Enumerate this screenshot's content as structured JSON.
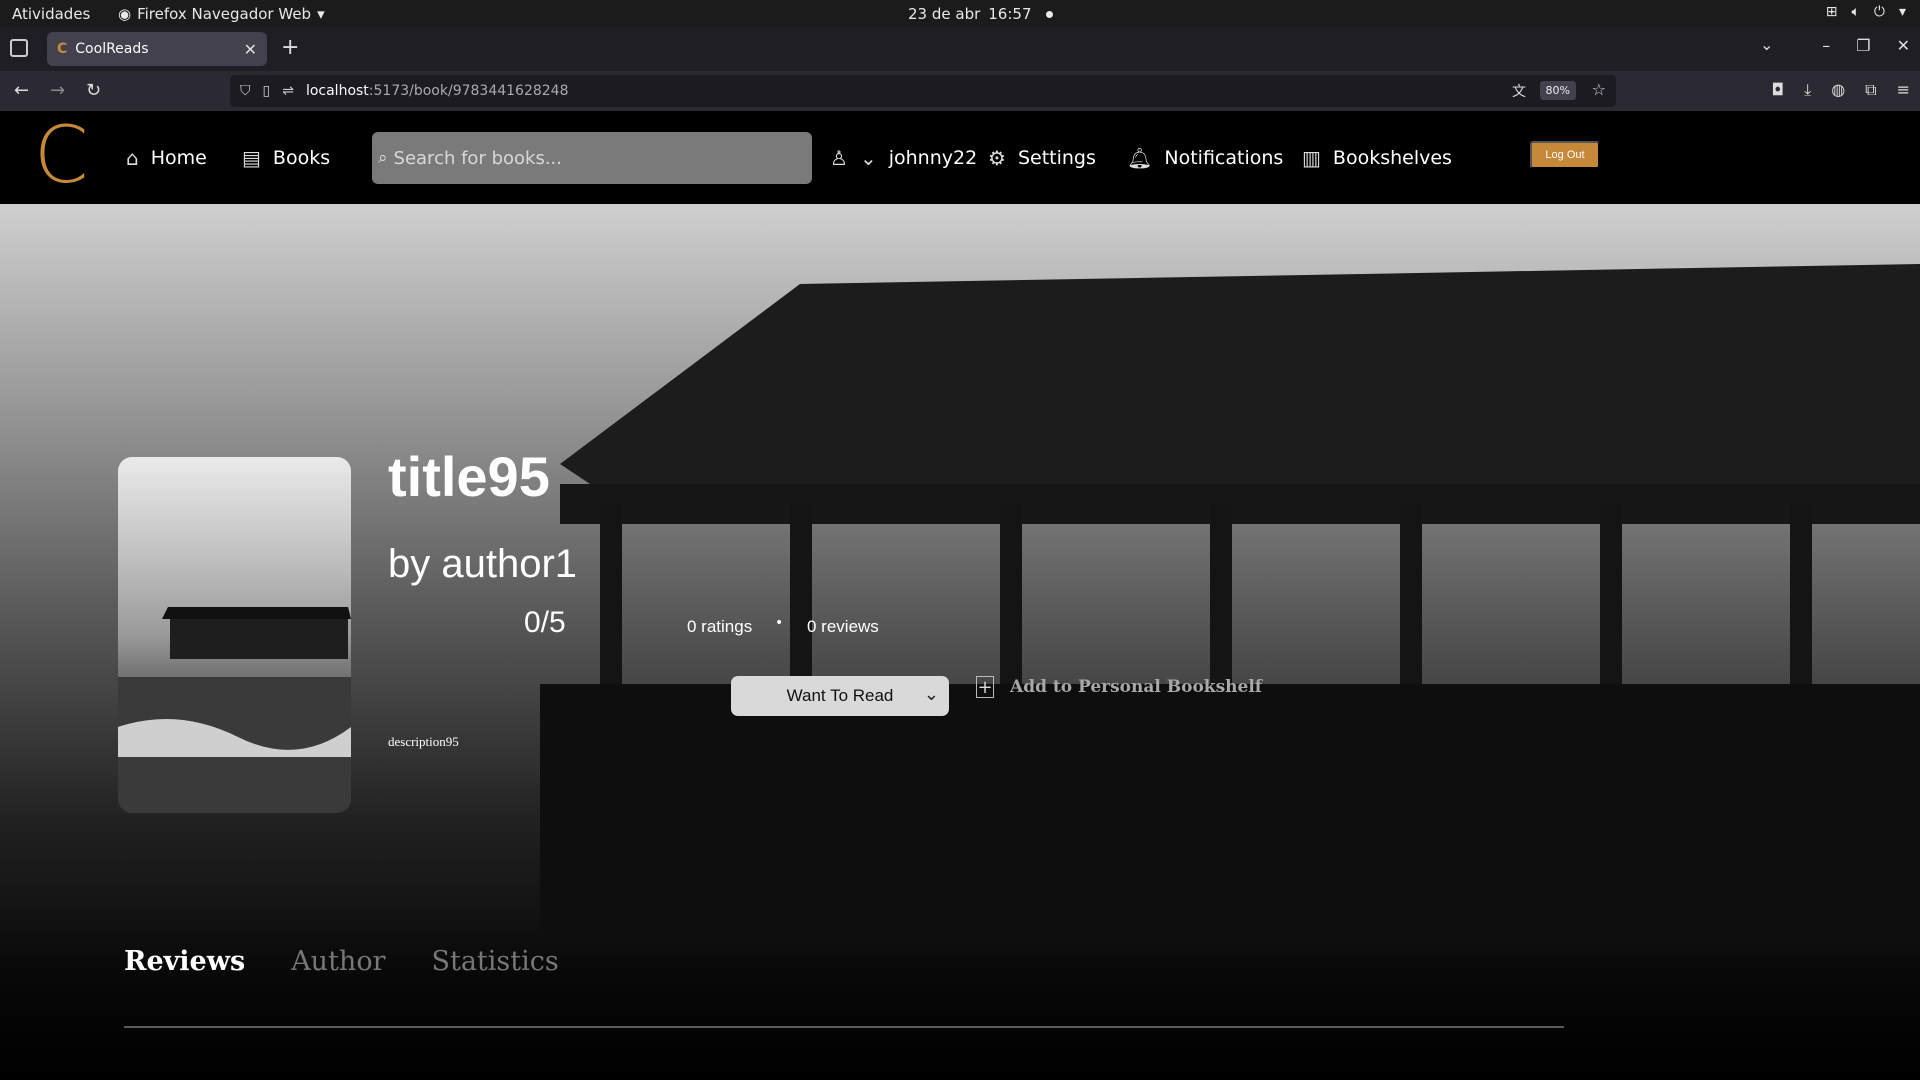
{
  "system_bar": {
    "activities": "Atividades",
    "app_name": "Firefox Navegador Web",
    "date": "23 de abr",
    "time": "16:57"
  },
  "browser": {
    "tab_title": "CoolReads",
    "url_host": "localhost",
    "url_rest": ":5173/book/9783441628248",
    "zoom": "80%"
  },
  "header": {
    "logo": "C",
    "nav": {
      "home": "Home",
      "books": "Books",
      "username": "johnny22",
      "settings": "Settings",
      "notifications": "Notifications",
      "bookshelves": "Bookshelves"
    },
    "search_placeholder": "Search for books...",
    "logout": "Log Out"
  },
  "book": {
    "title": "title95",
    "author": "by author1",
    "stars": "☆☆☆☆☆",
    "score": "0/5",
    "ratings": "0 ratings",
    "separator": "•",
    "reviews": "0 reviews",
    "status_select": "Want To Read",
    "add_to_shelf": "Add to Personal Bookshelf",
    "description": "description95"
  },
  "tabs": {
    "reviews": "Reviews",
    "author": "Author",
    "statistics": "Statistics"
  },
  "colors": {
    "accent": "#c6893a",
    "header_bg": "#000000"
  }
}
